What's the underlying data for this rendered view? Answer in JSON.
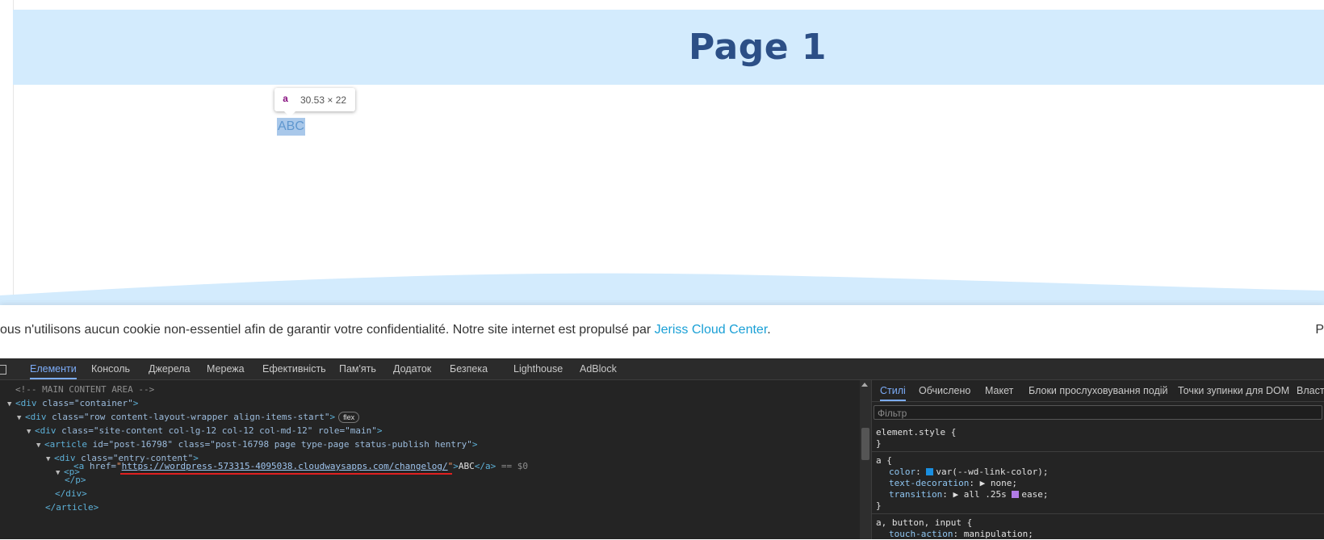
{
  "page": {
    "title": "Page 1",
    "tooltip": {
      "tag": "a",
      "size": "30.53 × 22"
    },
    "link_text": "ABC"
  },
  "cookie_bar": {
    "text": "ous n'utilisons aucun cookie non-essentiel afin de garantir votre confidentialité. Notre site internet est propulsé par ",
    "link": "Jeriss Cloud Center",
    "suffix": ".",
    "right_edge_text": "P"
  },
  "devtools": {
    "tabs": [
      "Елементи",
      "Консоль",
      "Джерела",
      "Мережа",
      "Ефективність",
      "Пам'ять",
      "Додаток",
      "Безпека",
      "Lighthouse",
      "AdBlock"
    ],
    "active_tab": "Елементи",
    "dom_lines": [
      {
        "comment": "<!-- MAIN CONTENT AREA -->"
      },
      {
        "tag": "div",
        "attrs": "class=\"container\""
      },
      {
        "tag": "div",
        "attrs": "class=\"row content-layout-wrapper align-items-start\"",
        "badge": "flex"
      },
      {
        "tag": "div",
        "attrs": "class=\"site-content col-lg-12 col-12 col-md-12\" role=\"main\""
      },
      {
        "tag": "article",
        "attrs": "id=\"post-16798\" class=\"post-16798 page type-page status-publish hentry\""
      },
      {
        "tag": "div",
        "attrs": "class=\"entry-content\""
      },
      {
        "tag": "p"
      },
      {
        "selected": true,
        "href": "https://wordpress-573315-4095038.cloudwaysapps.com/changelog/",
        "text": "ABC",
        "marker": "== $0"
      },
      {
        "close": "</p>"
      },
      {
        "close": "</div>"
      },
      {
        "close": "</article>"
      }
    ],
    "styles_tabs": [
      "Стилі",
      "Обчислено",
      "Макет",
      "Блоки прослуховування подій",
      "Точки зупинки для DOM",
      "Власт"
    ],
    "styles_active": "Стилі",
    "filter_placeholder": "Фільтр",
    "rules": {
      "element_style": "element.style {",
      "close": "}",
      "a_selector": "a {",
      "color_prop": "color",
      "color_value": "var(--wd-link-color);",
      "td_prop": "text-decoration",
      "td_value": "none;",
      "tr_prop": "transition",
      "tr_value": "all .25s",
      "tr_ease": "ease;",
      "next_selector": "a, button, input {",
      "next_prop": "touch-action",
      "next_value": "manipulation;"
    },
    "colors": {
      "accent": "#7cacf8",
      "link_swatch": "#1a8fe0",
      "selection": "#0f4a73"
    }
  }
}
